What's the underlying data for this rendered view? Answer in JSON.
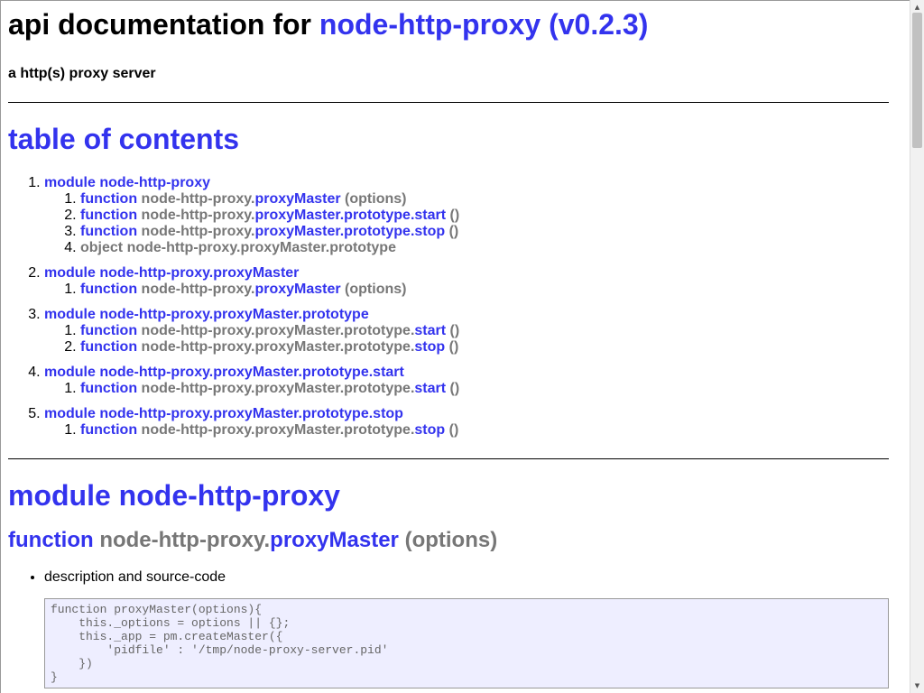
{
  "header": {
    "title_prefix": "api documentation for ",
    "title_link": "node-http-proxy (v0.2.3)",
    "subtitle": "a http(s) proxy server"
  },
  "toc": {
    "heading": "table of contents",
    "modules": [
      {
        "label": "module node-http-proxy",
        "items": [
          {
            "kw": "function",
            "path": "node-http-proxy.",
            "name": "proxyMaster",
            "sig": " (options)",
            "sig_blue": false
          },
          {
            "kw": "function",
            "path": "node-http-proxy.",
            "name": "proxyMaster.prototype.start",
            "sig": " ()",
            "sig_blue": true
          },
          {
            "kw": "function",
            "path": "node-http-proxy.",
            "name": "proxyMaster.prototype.stop",
            "sig": " ()",
            "sig_blue": true
          },
          {
            "kw": "object",
            "path": "node-http-proxy.proxyMaster.prototype",
            "name": "",
            "sig": "",
            "sig_blue": false,
            "plain": true
          }
        ]
      },
      {
        "label": "module node-http-proxy.proxyMaster",
        "items": [
          {
            "kw": "function",
            "path": "node-http-proxy.",
            "name": "proxyMaster",
            "sig": " (options)",
            "sig_blue": false
          }
        ]
      },
      {
        "label": "module node-http-proxy.proxyMaster.prototype",
        "items": [
          {
            "kw": "function",
            "path": "node-http-proxy.proxyMaster.prototype.",
            "name": "start",
            "sig": " ()",
            "sig_blue": true
          },
          {
            "kw": "function",
            "path": "node-http-proxy.proxyMaster.prototype.",
            "name": "stop",
            "sig": " ()",
            "sig_blue": true
          }
        ]
      },
      {
        "label": "module node-http-proxy.proxyMaster.prototype.start",
        "items": [
          {
            "kw": "function",
            "path": "node-http-proxy.proxyMaster.prototype.",
            "name": "start",
            "sig": " ()",
            "sig_blue": true
          }
        ]
      },
      {
        "label": "module node-http-proxy.proxyMaster.prototype.stop",
        "items": [
          {
            "kw": "function",
            "path": "node-http-proxy.proxyMaster.prototype.",
            "name": "stop",
            "sig": " ()",
            "sig_blue": true
          }
        ]
      }
    ]
  },
  "section": {
    "module_heading": "module node-http-proxy",
    "fn_kw": "function",
    "fn_path": "node-http-proxy.",
    "fn_name": "proxyMaster",
    "fn_sig": " (options)",
    "detail_label": "description and source-code",
    "code": "function proxyMaster(options){\n    this._options = options || {};\n    this._app = pm.createMaster({\n        'pidfile' : '/tmp/node-proxy-server.pid'\n    })\n}"
  },
  "colors": {
    "link": "#3333ee",
    "muted": "#777777",
    "code_bg": "#eeeeff"
  },
  "scrollbar": {
    "up_icon": "triangle-up-icon",
    "down_icon": "triangle-down-icon"
  }
}
